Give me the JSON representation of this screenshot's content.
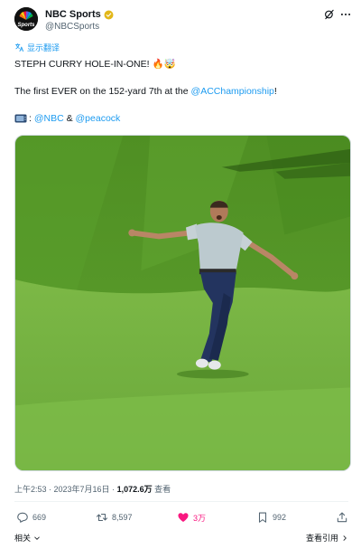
{
  "author": {
    "display_name": "NBC Sports",
    "handle": "@NBCSports",
    "avatar_text": "Sports"
  },
  "translate_label": "显示翻译",
  "tweet": {
    "line1_text": "STEPH CURRY HOLE-IN-ONE! ",
    "line1_emoji": "🔥🤯",
    "line2_prefix": "The first EVER on the 152-yard 7th at the ",
    "line2_link": "@ACChampionship",
    "line2_suffix": "!",
    "line3_colon": ":",
    "line3_link1": "@NBC",
    "line3_amp": " & ",
    "line3_link2": "@peacock"
  },
  "meta": {
    "time_date": "上午2:53 · 2023年7月16日 · ",
    "views": "1,072.6万",
    "views_label": " 查看"
  },
  "actions": {
    "replies": "669",
    "retweets": "8,597",
    "likes": "3万",
    "bookmarks": "992"
  },
  "bottom": {
    "related": "相关",
    "quotes": "查看引用"
  },
  "colors": {
    "link": "#1d9bf0",
    "like": "#f91880",
    "secondary_text": "#536471",
    "grass": "#5c9e2e"
  },
  "icons": [
    "grok-icon",
    "more-icon",
    "verified-badge-icon",
    "translate-icon",
    "tv-icon",
    "reply-icon",
    "retweet-icon",
    "like-icon",
    "bookmark-icon",
    "share-icon",
    "chevron-down-icon"
  ]
}
